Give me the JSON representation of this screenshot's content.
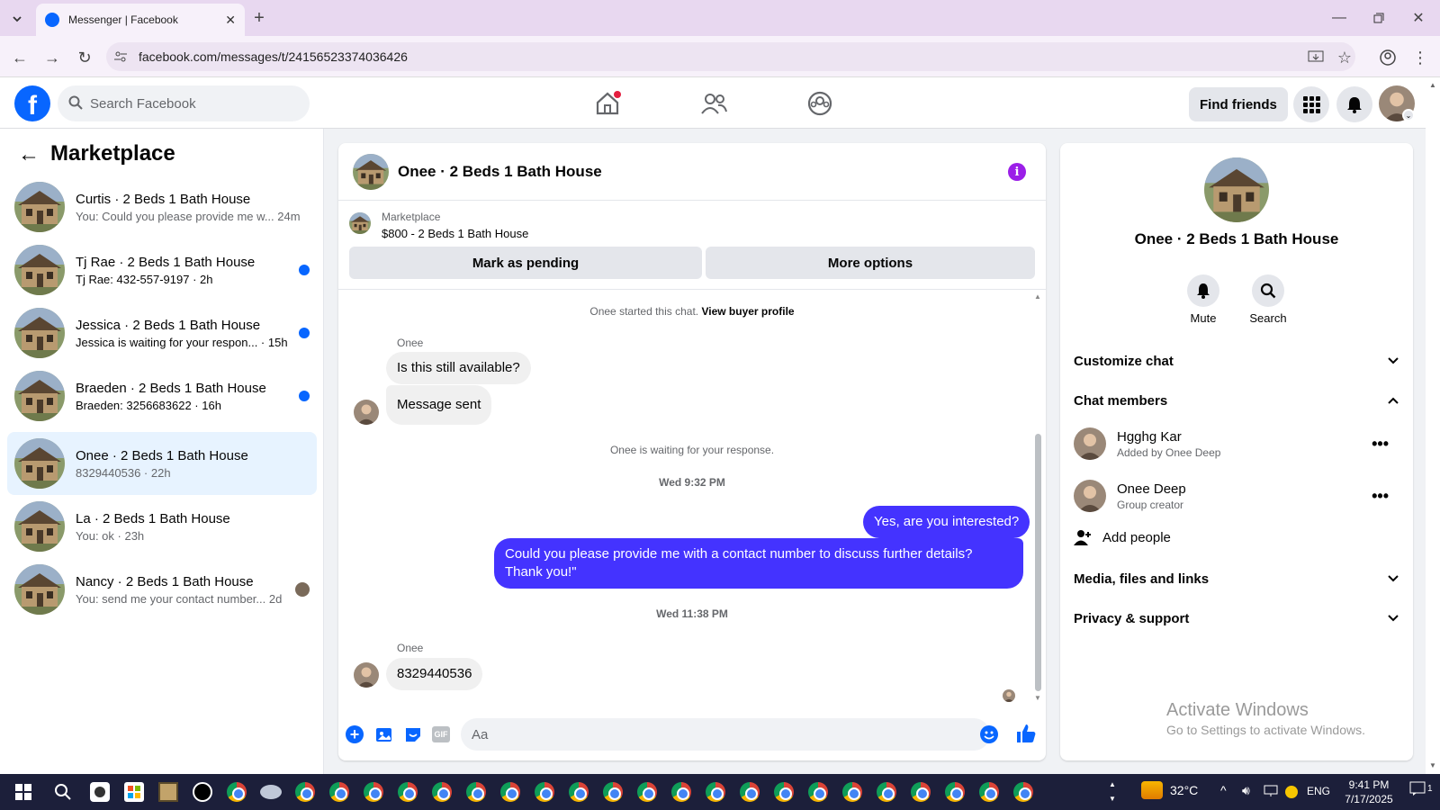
{
  "browser": {
    "tab_title": "Messenger | Facebook",
    "url": "facebook.com/messages/t/24156523374036426"
  },
  "header": {
    "search_placeholder": "Search Facebook",
    "find_friends": "Find friends"
  },
  "sidebar": {
    "title": "Marketplace",
    "conversations": [
      {
        "name": "Curtis · 2 Beds 1 Bath House",
        "preview": "You: Could you please provide me w...",
        "time": "24m",
        "unread": false
      },
      {
        "name": "Tj Rae · 2 Beds 1 Bath House",
        "preview": "Tj Rae: 432-557-9197",
        "time": "2h",
        "unread": true
      },
      {
        "name": "Jessica · 2 Beds 1 Bath House",
        "preview": "Jessica is waiting for your respon...",
        "time": "15h",
        "unread": true
      },
      {
        "name": "Braeden · 2 Beds 1 Bath House",
        "preview": "Braeden: 3256683622",
        "time": "16h",
        "unread": true
      },
      {
        "name": "Onee · 2 Beds 1 Bath House",
        "preview": "8329440536",
        "time": "22h",
        "unread": false,
        "active": true
      },
      {
        "name": "La · 2 Beds 1 Bath House",
        "preview": "You: ok",
        "time": "23h",
        "unread": false
      },
      {
        "name": "Nancy · 2 Beds 1 Bath House",
        "preview": "You: send me your contact number...",
        "time": "2d",
        "unread": false
      }
    ]
  },
  "chat": {
    "title": "Onee · 2 Beds 1 Bath House",
    "listing_source": "Marketplace",
    "listing_title": "$800 - 2 Beds 1 Bath House",
    "mark_pending": "Mark as pending",
    "more_options": "More options",
    "started_text": "Onee started this chat.",
    "view_buyer": "View buyer profile",
    "sender1": "Onee",
    "msg1": "Is this still available?",
    "msg2": "Message sent",
    "waiting": "Onee is waiting for your response.",
    "time1": "Wed 9:32 PM",
    "out1": "Yes, are you interested?",
    "out2": "Could you please provide me with a contact number to discuss further details? Thank you!\"",
    "time2": "Wed 11:38 PM",
    "sender2": "Onee",
    "msg3": "8329440536",
    "composer_placeholder": "Aa"
  },
  "info_panel": {
    "title": "Onee · 2 Beds 1 Bath House",
    "mute": "Mute",
    "search": "Search",
    "customize": "Customize chat",
    "members_title": "Chat members",
    "members": [
      {
        "name": "Hgghg Kar",
        "sub": "Added by Onee Deep"
      },
      {
        "name": "Onee Deep",
        "sub": "Group creator"
      }
    ],
    "add_people": "Add people",
    "media": "Media, files and links",
    "privacy": "Privacy & support",
    "activate_title": "Activate Windows",
    "activate_sub": "Go to Settings to activate Windows."
  },
  "taskbar": {
    "temperature": "32°C",
    "language": "ENG",
    "time": "9:41 PM",
    "date": "7/17/2025",
    "notif_count": "1"
  },
  "colors": {
    "fb_blue": "#0866ff",
    "outgoing_bubble": "#4433ff",
    "info_purple": "#9b1fe8"
  }
}
